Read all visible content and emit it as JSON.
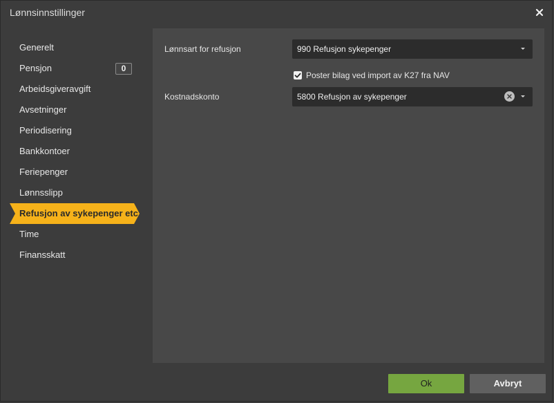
{
  "dialog": {
    "title": "Lønnsinnstillinger",
    "close_icon": "close-icon"
  },
  "sidebar": {
    "items": [
      {
        "label": "Generelt"
      },
      {
        "label": "Pensjon",
        "badge": "0"
      },
      {
        "label": "Arbeidsgiveravgift"
      },
      {
        "label": "Avsetninger"
      },
      {
        "label": "Periodisering"
      },
      {
        "label": "Bankkontoer"
      },
      {
        "label": "Feriepenger"
      },
      {
        "label": "Lønnsslipp"
      },
      {
        "label": "Refusjon av sykepenger etc",
        "active": true
      },
      {
        "label": "Time"
      },
      {
        "label": "Finansskatt"
      }
    ]
  },
  "form": {
    "lonnsart_label": "Lønnsart for refusjon",
    "lonnsart_value": "990 Refusjon sykepenger",
    "checkbox_label": "Poster bilag ved import av K27 fra NAV",
    "checkbox_checked": true,
    "kostnadskonto_label": "Kostnadskonto",
    "kostnadskonto_value": "5800 Refusjon av sykepenger"
  },
  "footer": {
    "ok_label": "Ok",
    "cancel_label": "Avbryt"
  },
  "colors": {
    "accent_active": "#f6b21a",
    "ok_button": "#76a640",
    "cancel_button": "#606060",
    "panel_bg": "#484848",
    "dialog_bg": "#3c3c3c"
  }
}
